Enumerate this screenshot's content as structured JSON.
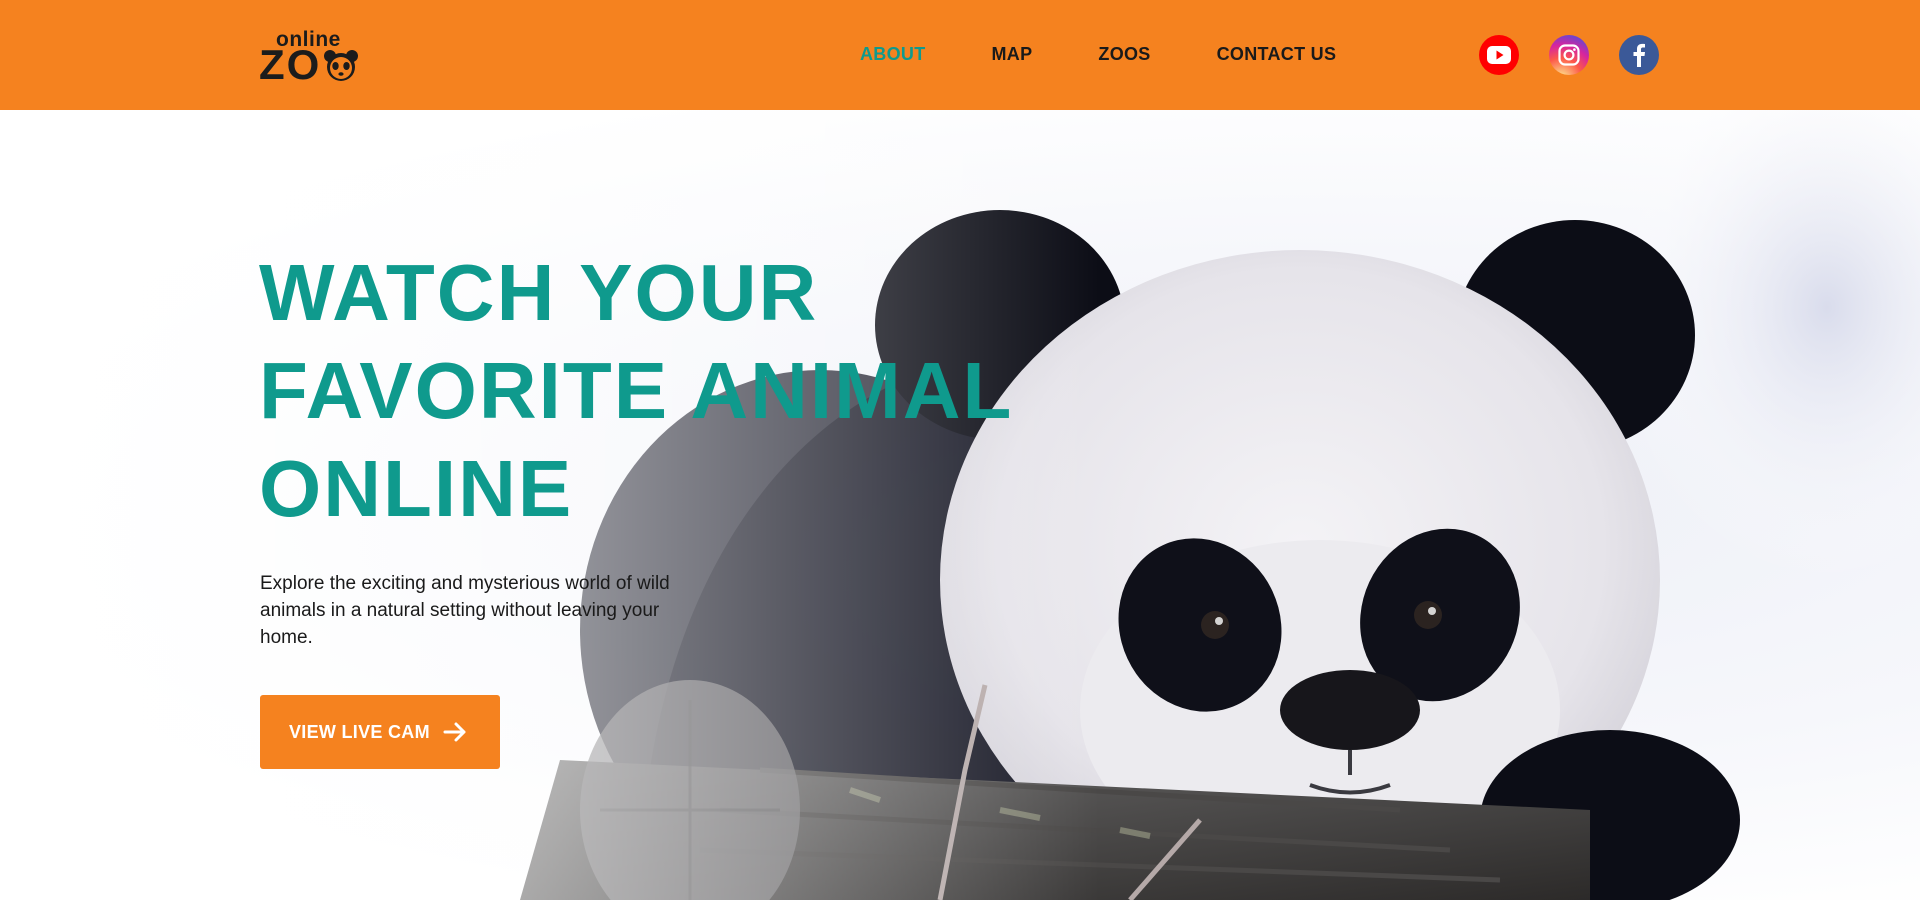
{
  "header": {
    "logo": {
      "small": "online",
      "big": "ZO"
    },
    "nav": [
      {
        "label": "ABOUT",
        "active": true
      },
      {
        "label": "MAP"
      },
      {
        "label": "ZOOS"
      },
      {
        "label": "CONTACT US"
      }
    ],
    "socials": [
      {
        "icon": "youtube-icon",
        "color": "#ff0000"
      },
      {
        "icon": "instagram-icon",
        "color": "#c13584"
      },
      {
        "icon": "facebook-icon",
        "color": "#3b5998"
      }
    ]
  },
  "hero": {
    "title_lines": [
      "WATCH YOUR",
      "FAVORITE ANIMAL",
      "ONLINE"
    ],
    "description": "Explore the exciting and mysterious world of wild animals in a natural setting without leaving your home.",
    "cta_label": "VIEW LIVE CAM",
    "cta_icon": "arrow-right-icon"
  },
  "colors": {
    "brand_orange": "#f5821f",
    "accent_teal": "#0f9a8d",
    "text_dark": "#1a1a1a"
  }
}
